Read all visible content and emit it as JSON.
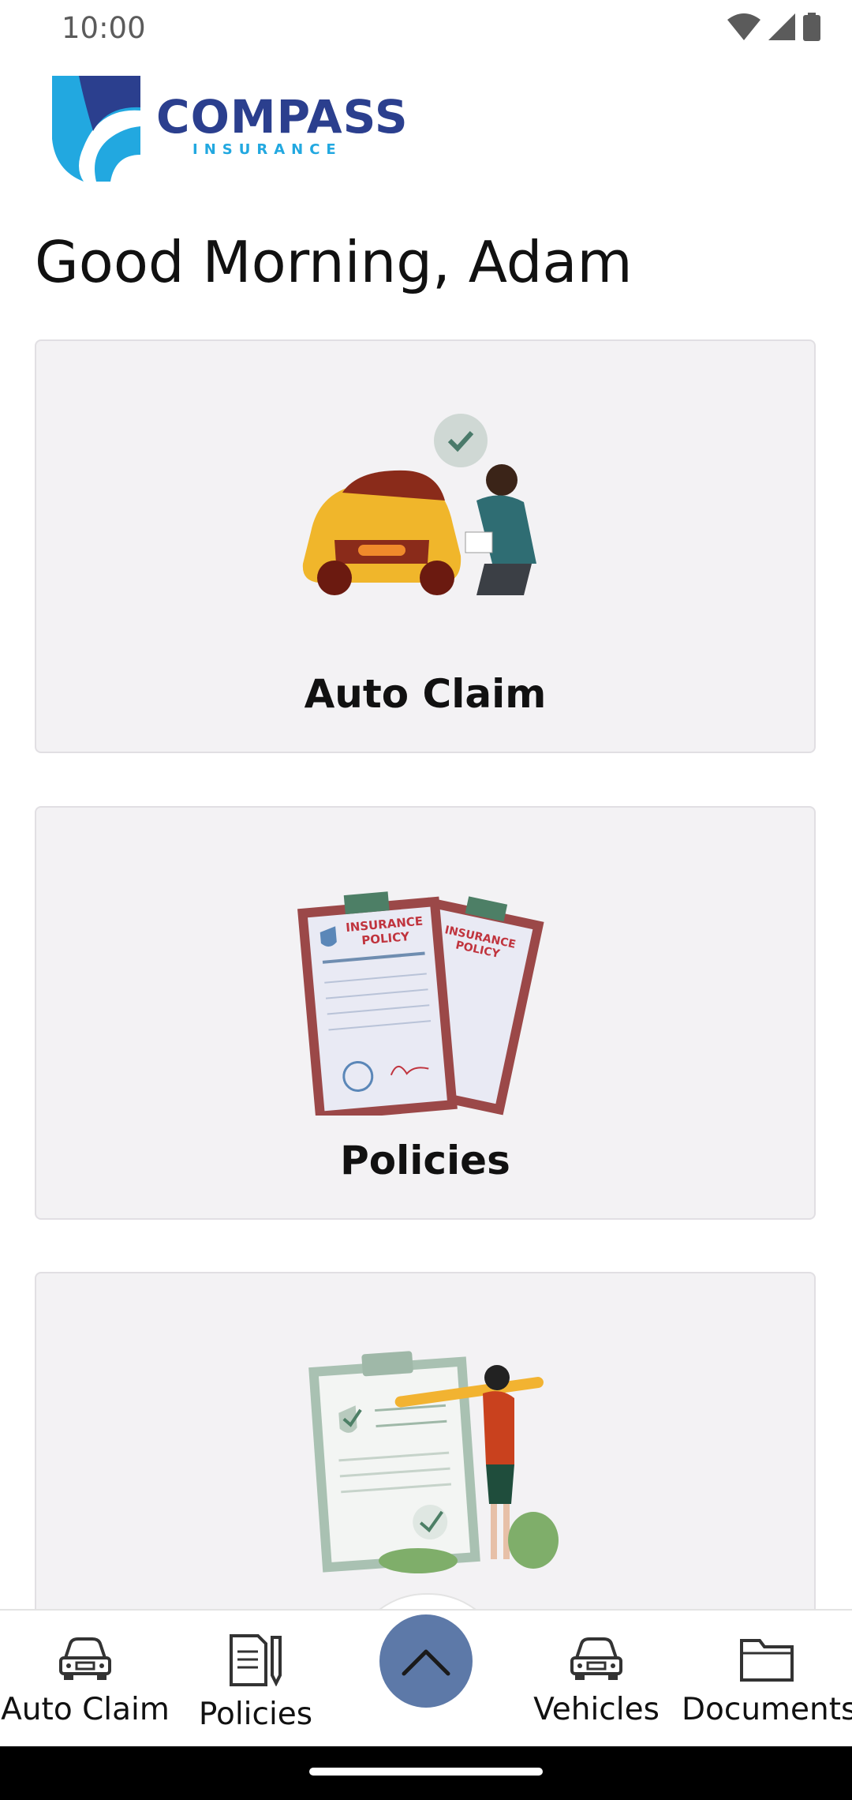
{
  "status_bar": {
    "time": "10:00"
  },
  "logo": {
    "name": "COMPASS",
    "sub": "INSURANCE"
  },
  "greeting": "Good Morning, Adam",
  "cards": [
    {
      "title": "Auto Claim",
      "illustration": "car-claim-illustration"
    },
    {
      "title": "Policies",
      "illustration": "insurance-policy-illustration"
    },
    {
      "title": "",
      "illustration": "checklist-illustration"
    }
  ],
  "bottom_nav": {
    "items": [
      {
        "label": "Auto Claim",
        "icon": "car-icon"
      },
      {
        "label": "Policies",
        "icon": "document-pen-icon"
      },
      {
        "label": "Vehicles",
        "icon": "car-icon"
      },
      {
        "label": "Documents",
        "icon": "folder-icon"
      }
    ],
    "fab_icon": "chevron-up-icon"
  },
  "colors": {
    "brand_navy": "#2b3f8e",
    "brand_blue": "#22a8e0",
    "fab": "#5d79a8",
    "card_bg": "#f3f2f4"
  }
}
